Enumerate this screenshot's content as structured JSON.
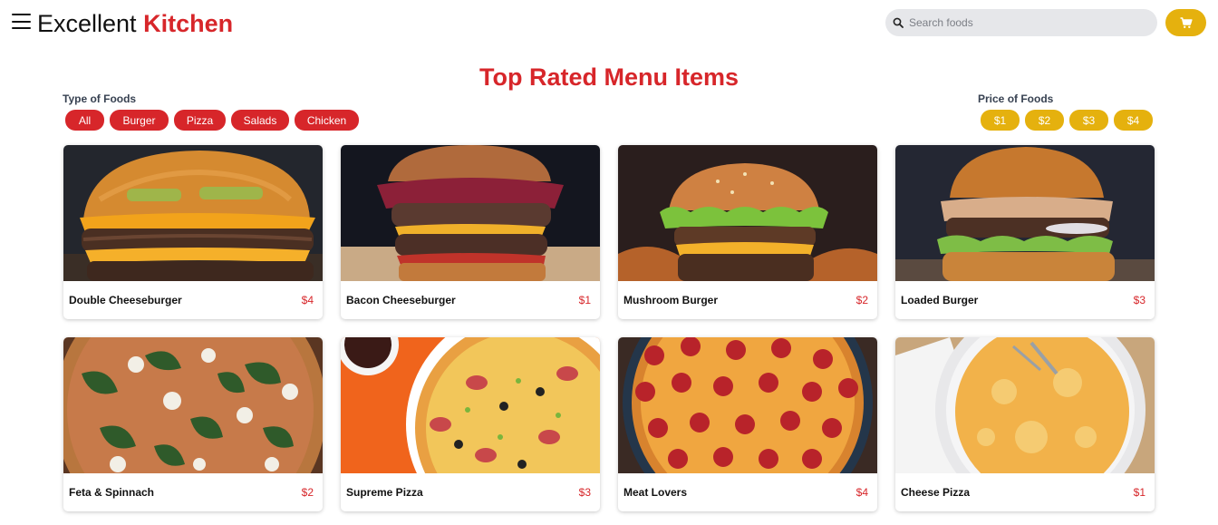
{
  "header": {
    "brand_primary": "Excellent",
    "brand_accent": "Kitchen",
    "search_placeholder": "Search foods",
    "icons": {
      "menu": "hamburger-menu-icon",
      "search": "search-icon",
      "cart": "shopping-cart-icon"
    }
  },
  "page_title": "Top Rated Menu Items",
  "filters": {
    "type_label": "Type of Foods",
    "types": [
      "All",
      "Burger",
      "Pizza",
      "Salads",
      "Chicken"
    ],
    "price_label": "Price of Foods",
    "prices": [
      "$1",
      "$2",
      "$3",
      "$4"
    ]
  },
  "items": [
    {
      "name": "Double Cheeseburger",
      "price": "$4",
      "kind": "burger"
    },
    {
      "name": "Bacon Cheeseburger",
      "price": "$1",
      "kind": "burger"
    },
    {
      "name": "Mushroom Burger",
      "price": "$2",
      "kind": "burger"
    },
    {
      "name": "Loaded Burger",
      "price": "$3",
      "kind": "burger"
    },
    {
      "name": "Feta & Spinnach",
      "price": "$2",
      "kind": "pizza"
    },
    {
      "name": "Supreme Pizza",
      "price": "$3",
      "kind": "pizza"
    },
    {
      "name": "Meat Lovers",
      "price": "$4",
      "kind": "pizza"
    },
    {
      "name": "Cheese Pizza",
      "price": "$1",
      "kind": "pizza"
    }
  ],
  "colors": {
    "accent_red": "#d7262a",
    "accent_yellow": "#e5b10e",
    "search_bg": "#e6e7ea"
  }
}
